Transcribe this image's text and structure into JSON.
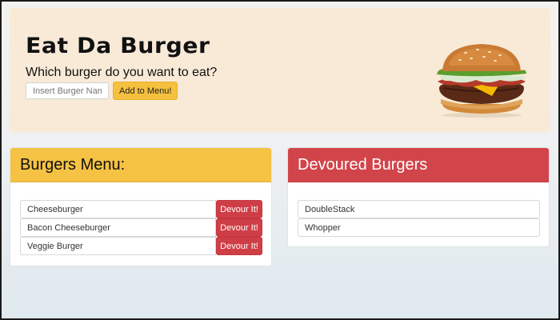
{
  "hero": {
    "title": "Eat Da Burger",
    "subtitle": "Which burger do you want to eat?",
    "input_placeholder": "Insert Burger Name",
    "add_button": "Add to Menu!"
  },
  "menu": {
    "header": "Burgers Menu:",
    "button_label": "Devour It!",
    "items": [
      "Cheeseburger",
      "Bacon Cheeseburger",
      "Veggie Burger"
    ]
  },
  "devoured": {
    "header": "Devoured Burgers",
    "items": [
      "DoubleStack",
      "Whopper"
    ]
  },
  "colors": {
    "hero_bg": "#f8ead7",
    "accent_yellow": "#f5c244",
    "accent_red": "#d1444a"
  }
}
